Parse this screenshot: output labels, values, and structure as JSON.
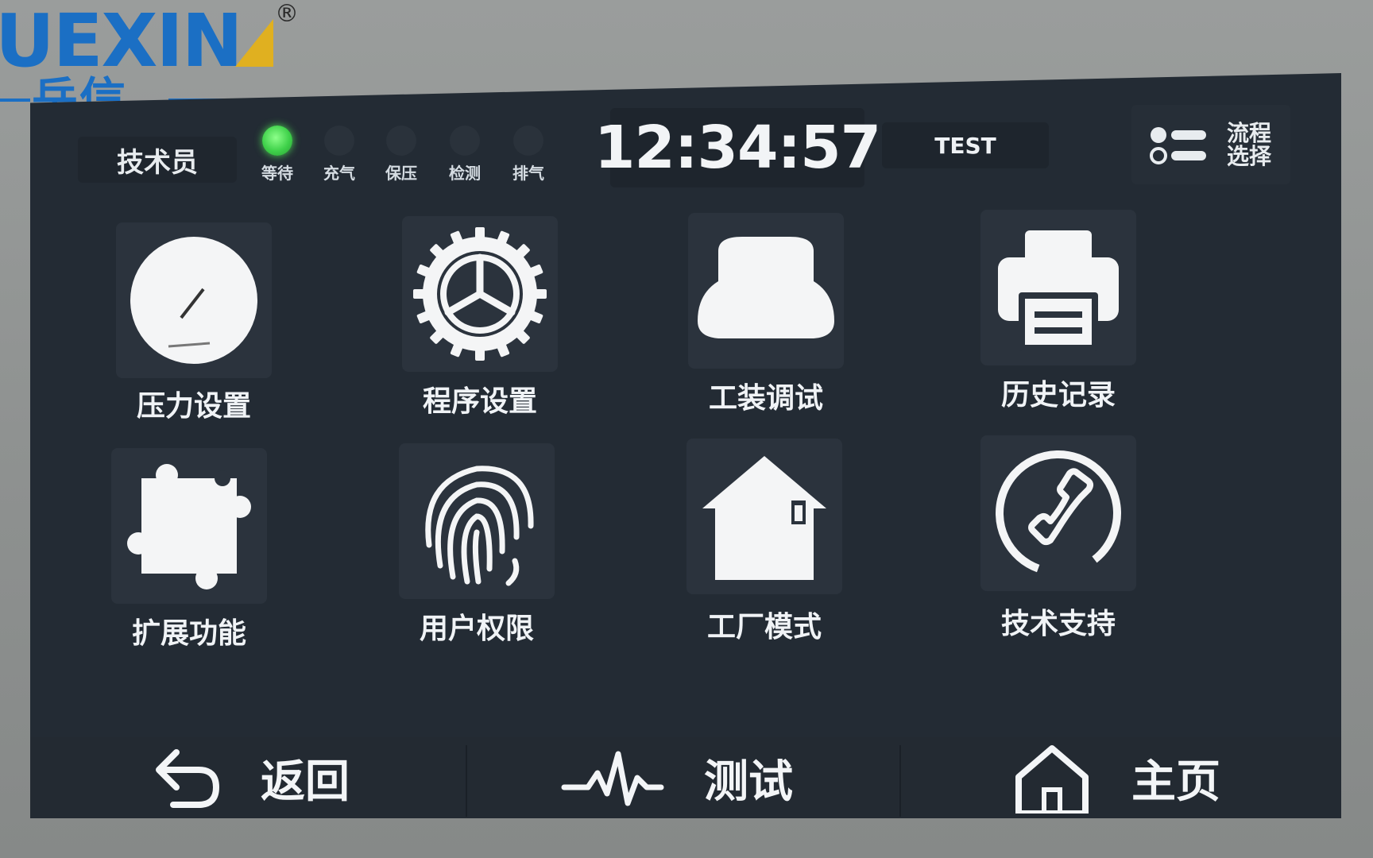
{
  "logo": {
    "brand_latin": "UEXIN",
    "brand_cn": "岳信",
    "registered": "®",
    "brand_color": "#1b6fc4"
  },
  "status_bar": {
    "role": "技术员",
    "indicators": [
      {
        "label": "等待",
        "active": true
      },
      {
        "label": "充气",
        "active": false
      },
      {
        "label": "保压",
        "active": false
      },
      {
        "label": "检测",
        "active": false
      },
      {
        "label": "排气",
        "active": false
      }
    ],
    "indicator_active_color": "#3fd14a",
    "clock": "12:34:57",
    "program_name": "TEST",
    "flow_select_label_1": "流程",
    "flow_select_label_2": "选择"
  },
  "menu": [
    {
      "label": "压力设置",
      "icon": "pressure-gauge-icon"
    },
    {
      "label": "程序设置",
      "icon": "gear-icon"
    },
    {
      "label": "工装调试",
      "icon": "fixture-icon"
    },
    {
      "label": "历史记录",
      "icon": "printer-icon"
    },
    {
      "label": "扩展功能",
      "icon": "puzzle-icon"
    },
    {
      "label": "用户权限",
      "icon": "fingerprint-icon"
    },
    {
      "label": "工厂模式",
      "icon": "house-icon"
    },
    {
      "label": "技术支持",
      "icon": "phone-icon"
    }
  ],
  "bottom_nav": {
    "back": "返回",
    "test": "测试",
    "home": "主页"
  },
  "colors": {
    "screen_bg": "#232b34",
    "tile_bg": "#2b333d",
    "text": "#f0f3f6"
  }
}
